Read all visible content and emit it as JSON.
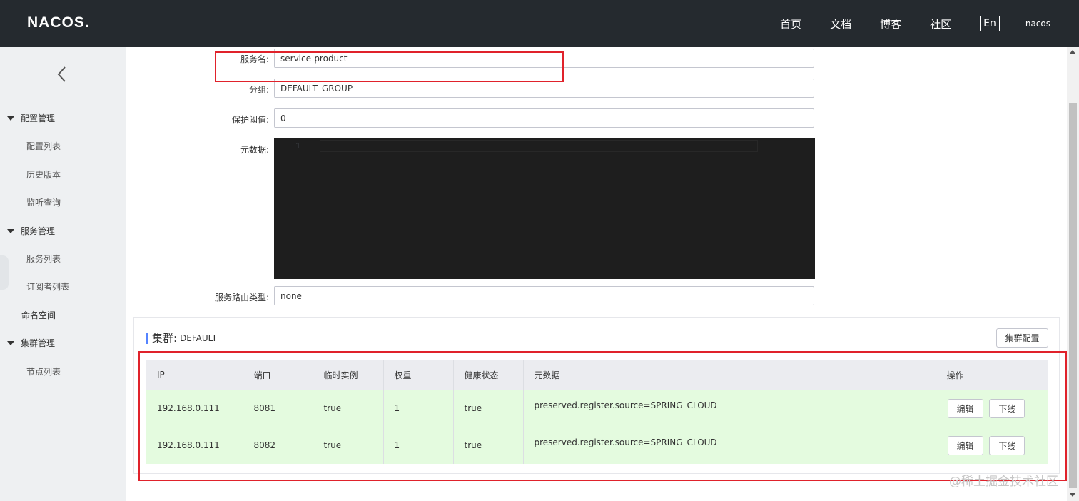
{
  "header": {
    "logo": "NACOS.",
    "nav": [
      "首页",
      "文档",
      "博客",
      "社区"
    ],
    "lang": "En",
    "user": "nacos"
  },
  "sidebar": {
    "groups": [
      {
        "label": "配置管理",
        "items": [
          "配置列表",
          "历史版本",
          "监听查询"
        ]
      },
      {
        "label": "服务管理",
        "items": [
          "服务列表",
          "订阅者列表"
        ]
      },
      {
        "label": "命名空间",
        "items": []
      },
      {
        "label": "集群管理",
        "items": [
          "节点列表"
        ]
      }
    ]
  },
  "form": {
    "service_name_label": "服务名:",
    "service_name_value": "service-product",
    "group_label": "分组:",
    "group_value": "DEFAULT_GROUP",
    "protect_label": "保护阈值:",
    "protect_value": "0",
    "metadata_label": "元数据:",
    "metadata_line": "1",
    "route_label": "服务路由类型:",
    "route_value": "none"
  },
  "cluster": {
    "title": "集群:",
    "name": "DEFAULT",
    "config_button": "集群配置",
    "columns": [
      "IP",
      "端口",
      "临时实例",
      "权重",
      "健康状态",
      "元数据",
      "操作"
    ],
    "rows": [
      {
        "ip": "192.168.0.111",
        "port": "8081",
        "ephemeral": "true",
        "weight": "1",
        "healthy": "true",
        "metadata": "preserved.register.source=SPRING_CLOUD",
        "edit": "编辑",
        "offline": "下线"
      },
      {
        "ip": "192.168.0.111",
        "port": "8082",
        "ephemeral": "true",
        "weight": "1",
        "healthy": "true",
        "metadata": "preserved.register.source=SPRING_CLOUD",
        "edit": "编辑",
        "offline": "下线"
      }
    ]
  },
  "watermark": "@稀土掘金技术社区",
  "colors": {
    "topbar": "#252a2f",
    "sidebar": "#eef0f2",
    "row_healthy": "#e4fbdf",
    "annotation": "#e0222b",
    "accent": "#5584ff"
  }
}
